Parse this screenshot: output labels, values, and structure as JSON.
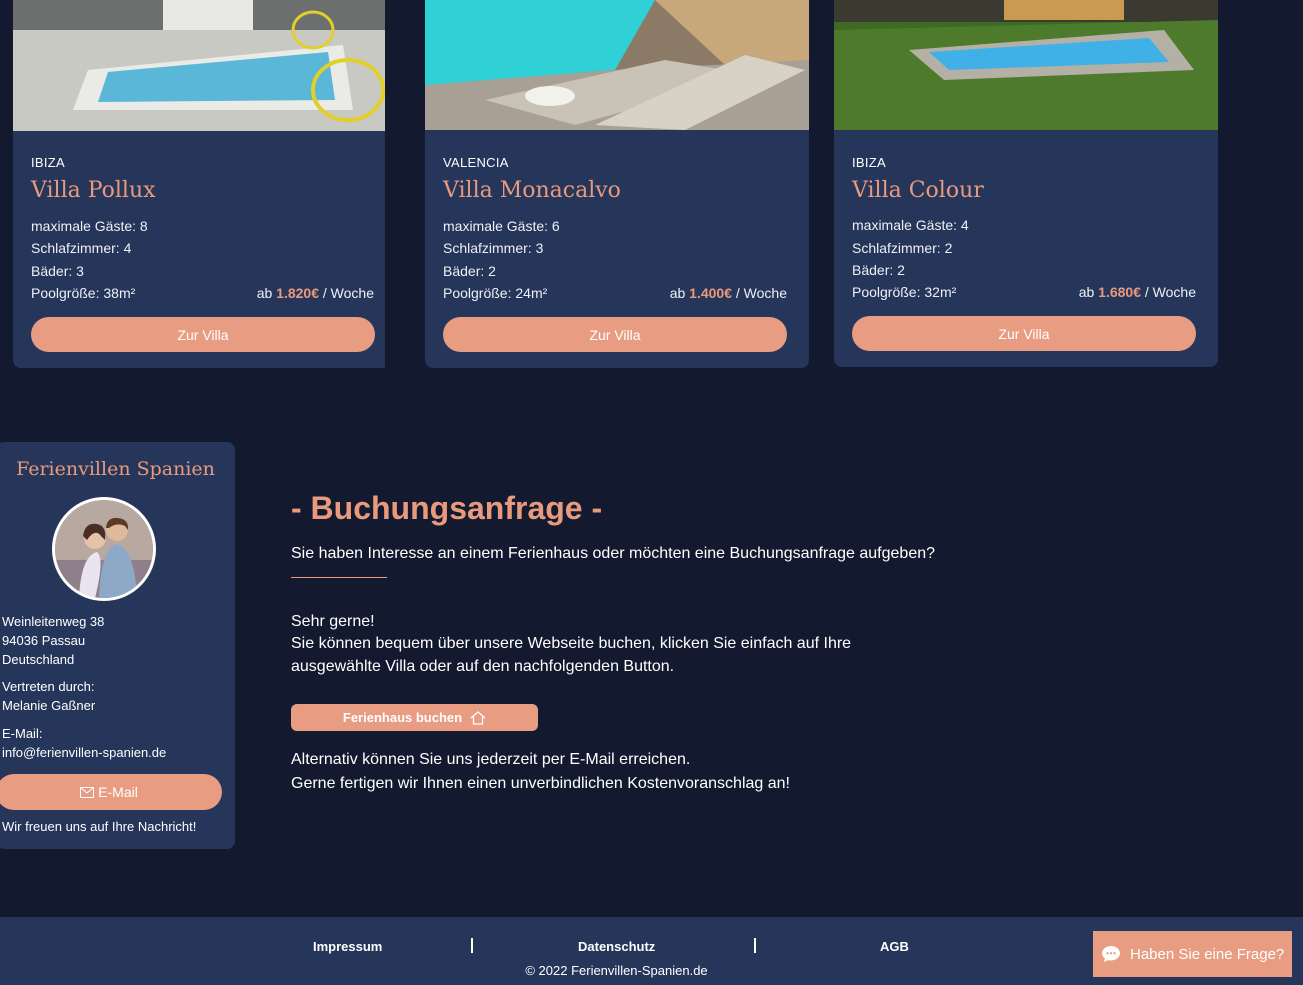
{
  "villas": [
    {
      "region": "IBIZA",
      "name": "Villa Pollux",
      "guests": "maximale Gäste: 8",
      "bedrooms": "Schlafzimmer: 4",
      "baths": "Bäder: 3",
      "pool": "Poolgröße: 38m²",
      "price_prefix": "ab",
      "price": "1.820€",
      "price_suffix": "/ Woche",
      "button": "Zur Villa"
    },
    {
      "region": "VALENCIA",
      "name": "Villa Monacalvo",
      "guests": "maximale Gäste: 6",
      "bedrooms": "Schlafzimmer: 3",
      "baths": "Bäder: 2",
      "pool": "Poolgröße: 24m²",
      "price_prefix": "ab",
      "price": "1.400€",
      "price_suffix": "/ Woche",
      "button": "Zur Villa"
    },
    {
      "region": "IBIZA",
      "name": "Villa Colour",
      "guests": "maximale Gäste: 4",
      "bedrooms": "Schlafzimmer: 2",
      "baths": "Bäder: 2",
      "pool": "Poolgröße: 32m²",
      "price_prefix": "ab",
      "price": "1.680€",
      "price_suffix": "/ Woche",
      "button": "Zur Villa"
    }
  ],
  "contact": {
    "title": "Ferienvillen Spanien",
    "street": "Weinleitenweg 38",
    "city": "94036 Passau",
    "country": "Deutschland",
    "rep_label": "Vertreten durch:",
    "rep_name": "Melanie Gaßner",
    "email_label": "E-Mail:",
    "email": "info@ferienvillen-spanien.de",
    "email_button": "E-Mail",
    "closing": "Wir freuen uns auf Ihre Nachricht!"
  },
  "booking": {
    "headline": "- Buchungsanfrage -",
    "intro": "Sie haben Interesse an einem Ferienhaus oder möchten eine Buchungsanfrage aufgeben?",
    "line1": "Sehr gerne!",
    "line2": "Sie können bequem über unsere Webseite buchen, klicken Sie einfach auf Ihre",
    "line3": "ausgewählte Villa oder auf den nachfolgenden Button.",
    "button": "Ferienhaus buchen",
    "alt1": "Alternativ können Sie uns jederzeit per E-Mail erreichen.",
    "alt2": "Gerne fertigen wir Ihnen einen unverbindlichen Kostenvoranschlag an!"
  },
  "footer": {
    "impressum": "Impressum",
    "datenschutz": "Datenschutz",
    "agb": "AGB",
    "copyright": "© 2022 Ferienvillen-Spanien.de"
  },
  "chat": {
    "label": "Haben Sie eine Frage?"
  },
  "colors": {
    "background": "#131a30",
    "card": "#25365a",
    "accent": "#e99a7d",
    "button": "#e89c82"
  }
}
